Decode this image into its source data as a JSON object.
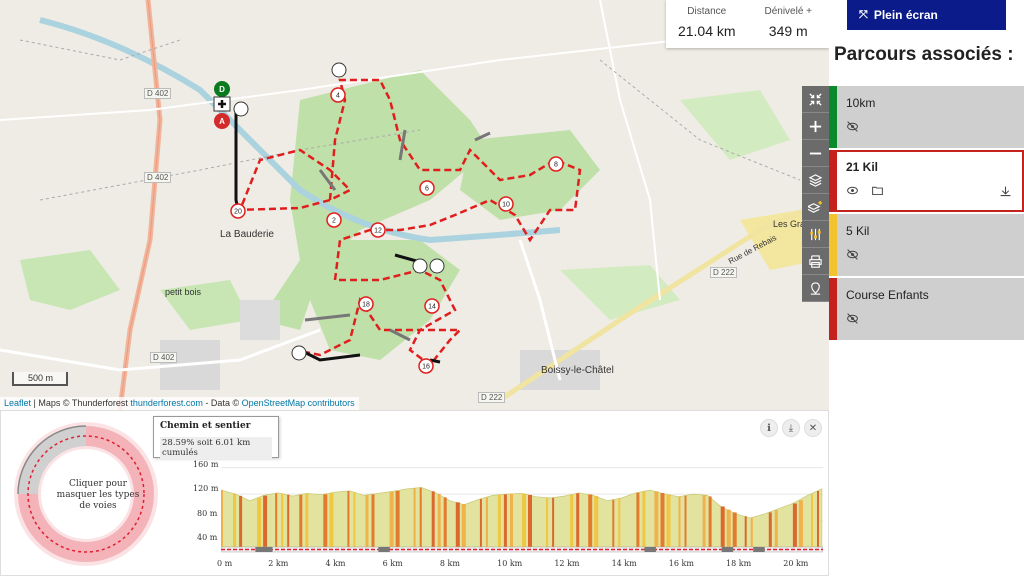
{
  "map": {
    "stats": {
      "distance_label": "Distance",
      "distance_value": "21.04 km",
      "elevation_label": "Dénivelé +",
      "elevation_value": "349 m"
    },
    "labels": {
      "place1": "La Bauderie",
      "place2": "petit bois",
      "place3": "Boissy-le-Châtel",
      "place4": "Les Granges",
      "road1": "Rue de Rebais",
      "roadtag1": "D 402",
      "roadtag2": "D 402",
      "roadtag3": "D 402",
      "roadtag4": "D 222",
      "roadtag5": "D 222"
    },
    "markers": [
      "2",
      "4",
      "6",
      "8",
      "10",
      "12",
      "14",
      "16",
      "18",
      "20"
    ],
    "start_label": "D",
    "end_label": "A",
    "scale": "500 m",
    "attribution": {
      "leaflet": "Leaflet",
      "sep1": " | Maps © Thunderforest ",
      "tf_link": "thunderforest.com",
      "sep2": " - Data © ",
      "osm_link": "OpenStreetMap contributors"
    },
    "toolbar_icons": [
      "collapse-icon",
      "zoom-in-icon",
      "zoom-out-icon",
      "layers-icon",
      "layers-add-icon",
      "settings-sliders-icon",
      "print-icon",
      "location-icon"
    ]
  },
  "panel": {
    "fullscreen_label": "Plein écran",
    "title": "Parcours associés :",
    "routes": [
      {
        "name": "10km",
        "color": "#0a8a2a"
      },
      {
        "name": "21 Kil",
        "color": "#c4221c"
      },
      {
        "name": "5 Kil",
        "color": "#f2c230"
      },
      {
        "name": "Course Enfants",
        "color": "#c4221c"
      }
    ]
  },
  "profile": {
    "donut_text": "Cliquer pour masquer les types de voies",
    "tooltip_title": "Chemin et sentier",
    "tooltip_value": "28.59% soit 6.01 km cumulés",
    "colors": {
      "track": "#e02030",
      "path": "#999999",
      "fill": "#e3e3a0"
    }
  },
  "chart_data": {
    "type": "area",
    "title": "",
    "xlabel": "",
    "ylabel": "",
    "x_ticks": [
      "0 m",
      "2 km",
      "4 km",
      "6 km",
      "8 km",
      "10 km",
      "12 km",
      "14 km",
      "16 km",
      "18 km",
      "20 km"
    ],
    "y_ticks": [
      "160 m",
      "120 m",
      "80 m",
      "40 m"
    ],
    "ylim": [
      40,
      170
    ],
    "xlim": [
      0,
      21.04
    ],
    "x": [
      0,
      0.5,
      1,
      1.5,
      2,
      2.5,
      3,
      3.5,
      4,
      4.5,
      5,
      5.5,
      6,
      6.5,
      7,
      7.5,
      8,
      8.5,
      9,
      9.5,
      10,
      10.5,
      11,
      11.5,
      12,
      12.5,
      13,
      13.5,
      14,
      14.5,
      15,
      15.5,
      16,
      16.5,
      17,
      17.5,
      18,
      18.5,
      19,
      19.5,
      20,
      20.5,
      21
    ],
    "y": [
      126,
      120,
      110,
      118,
      122,
      117,
      121,
      119,
      123,
      125,
      118,
      121,
      124,
      128,
      130,
      122,
      110,
      104,
      112,
      118,
      120,
      121,
      116,
      114,
      117,
      122,
      118,
      110,
      114,
      122,
      126,
      120,
      116,
      120,
      118,
      100,
      90,
      84,
      90,
      98,
      106,
      118,
      128
    ]
  }
}
